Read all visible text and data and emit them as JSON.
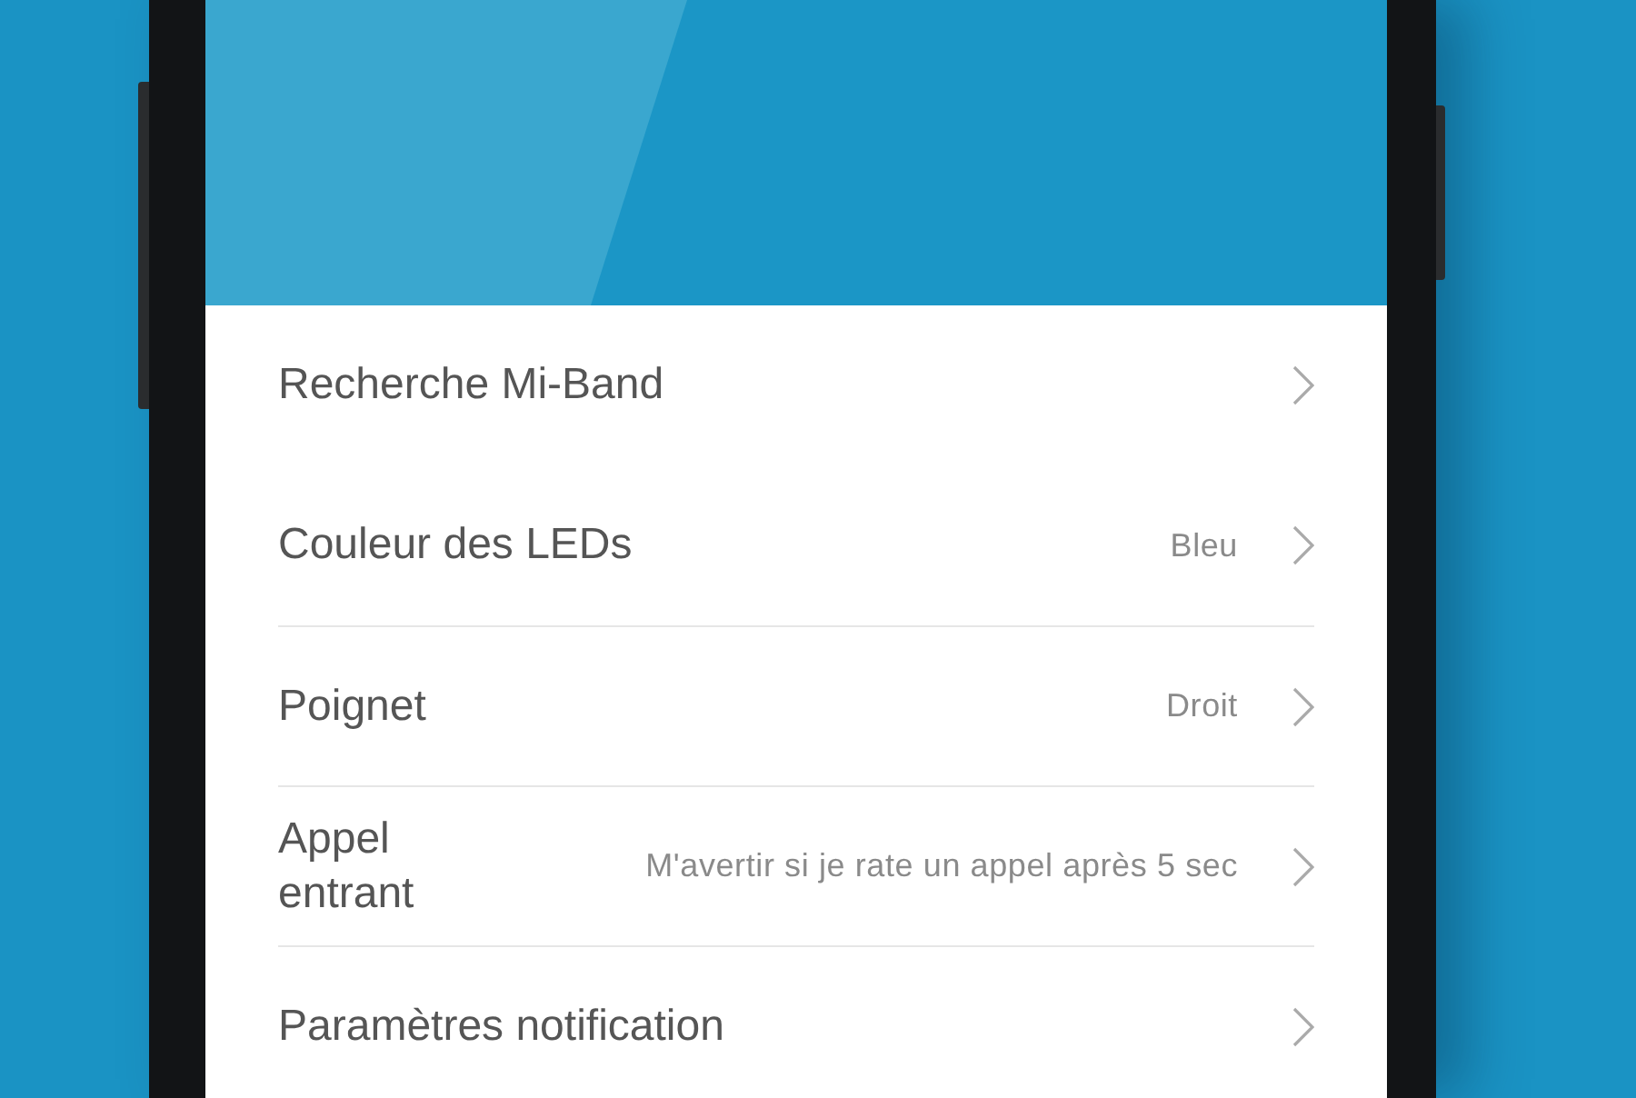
{
  "rows": [
    {
      "label": "Recherche Mi-Band"
    },
    {
      "label": "Couleur des LEDs",
      "value": "Bleu"
    },
    {
      "label": "Poignet",
      "value": "Droit"
    },
    {
      "label": "Appel entrant",
      "value": "M'avertir si je rate un appel après 5 sec"
    },
    {
      "label": "Paramètres notification"
    }
  ]
}
